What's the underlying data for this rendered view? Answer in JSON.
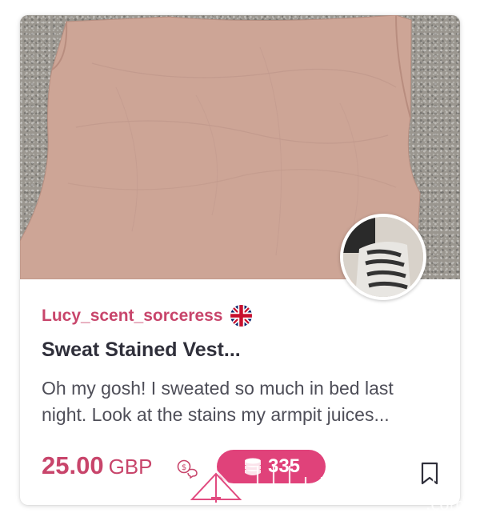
{
  "listing": {
    "seller_name": "Lucy_scent_sorceress",
    "seller_flag": "uk-flag-icon",
    "title": "Sweat Stained Vest...",
    "description": "Oh my gosh! I sweated so much in bed last night. Look at the stains my armpit juices...",
    "price_amount": "25.00",
    "price_currency": "GBP",
    "coin_price": "335"
  },
  "icons": {
    "offer": "make-offer-icon",
    "coins": "coins-icon",
    "bookmark": "bookmark-icon"
  },
  "colors": {
    "accent": "#c8456b",
    "badge": "#e0427a",
    "title": "#2f2f3a",
    "text": "#4e4e58"
  }
}
